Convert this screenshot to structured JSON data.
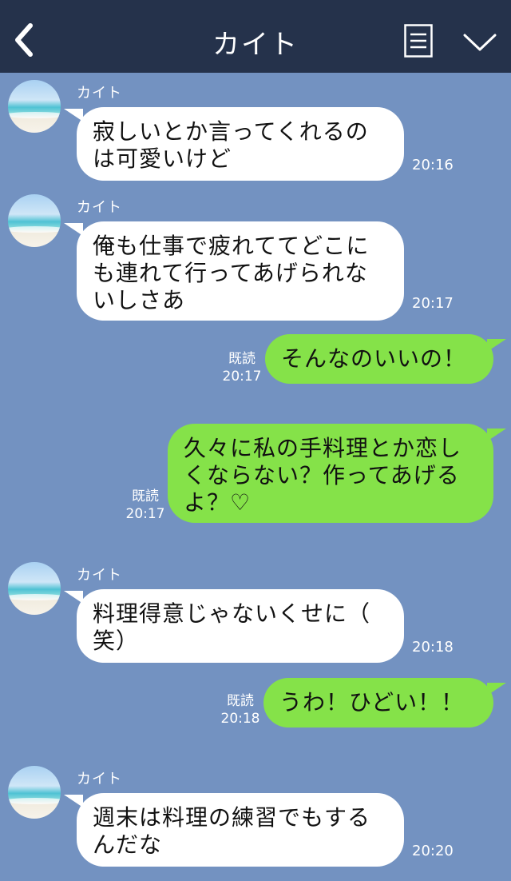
{
  "header": {
    "title": "カイト",
    "back_icon": "chevron-left-icon",
    "menu_icon": "list-menu-icon",
    "dropdown_icon": "chevron-down-icon",
    "bg_color": "#25324b"
  },
  "chat": {
    "bg_color": "#7392c1",
    "incoming_color": "#ffffff",
    "outgoing_color": "#85e249",
    "messages": [
      {
        "sender": "カイト",
        "text": "寂しいとか言ってくれるの\nは可愛いけど",
        "time": "20:16"
      },
      {
        "sender": "カイト",
        "text": "俺も仕事で疲れててどこに\nも連れて行ってあげられな\nいしさあ",
        "time": "20:17"
      },
      {
        "read": "既読",
        "text": "そんなのいいの！",
        "time": "20:17"
      },
      {
        "read": "既読",
        "text": "久々に私の手料理とか恋し\nくならない？作ってあげる\nよ？♡",
        "time": "20:17"
      },
      {
        "sender": "カイト",
        "text": "料理得意じゃないくせに（\n笑）",
        "time": "20:18"
      },
      {
        "read": "既読",
        "text": "うわ！ひどい！！",
        "time": "20:18"
      },
      {
        "sender": "カイト",
        "text": "週末は料理の練習でもする\nんだな",
        "time": "20:20"
      }
    ]
  }
}
